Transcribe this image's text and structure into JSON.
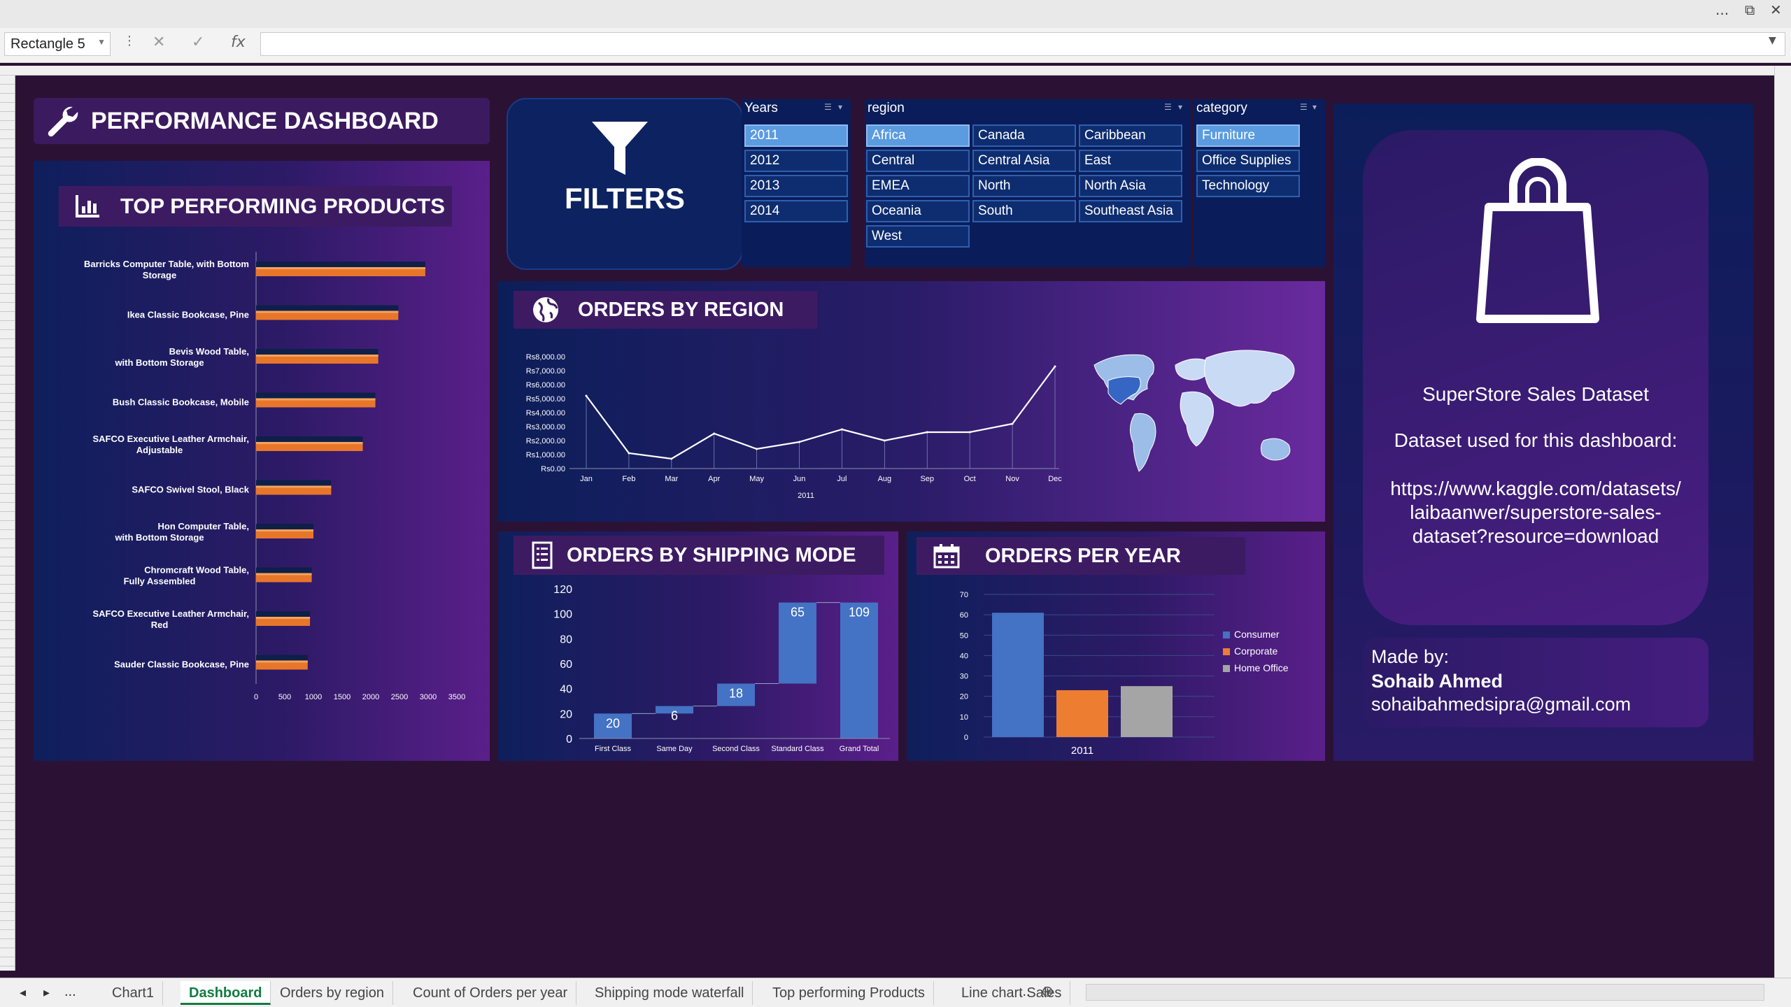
{
  "excel": {
    "name_box": "Rectangle 5",
    "formula": "",
    "sheet_tabs": [
      {
        "label": "Chart1",
        "active": false
      },
      {
        "label": "Dashboard",
        "active": true
      },
      {
        "label": "Orders by region",
        "active": false
      },
      {
        "label": "Count of Orders per year",
        "active": false
      },
      {
        "label": "Shipping mode waterfall",
        "active": false
      },
      {
        "label": "Top performing Products",
        "active": false
      },
      {
        "label": "Line chart Sales",
        "active": false
      }
    ],
    "tab_ellipsis": "...",
    "window_controls": [
      "...",
      "⧉",
      "✕"
    ]
  },
  "dashboard": {
    "main_title": "PERFORMANCE DASHBOARD",
    "filters_label": "FILTERS",
    "top_products": {
      "title": "TOP PERFORMING PRODUCTS",
      "chart_data": {
        "type": "bar",
        "orientation": "horizontal",
        "categories": [
          "Barricks Computer Table, with Bottom Storage",
          "Ikea Classic Bookcase, Pine",
          "Bevis Wood Table, with Bottom Storage",
          "Bush Classic Bookcase, Mobile",
          "SAFCO Executive Leather Armchair, Adjustable",
          "SAFCO Swivel Stool, Black",
          "Hon Computer Table, with Bottom Storage",
          "Chromcraft Wood Table, Fully Assembled",
          "SAFCO Executive Leather Armchair, Red",
          "Sauder Classic Bookcase, Pine"
        ],
        "series": [
          {
            "color": "#0e1f4a",
            "values": [
              2950,
              2480,
              2130,
              2080,
              1860,
              1310,
              1000,
              970,
              940,
              900
            ]
          },
          {
            "color": "#e8762a",
            "values": [
              2950,
              2480,
              2130,
              2080,
              1860,
              1310,
              1000,
              970,
              940,
              900
            ]
          }
        ],
        "ticks": [
          "0",
          "500",
          "1000",
          "1500",
          "2000",
          "2500",
          "3000",
          "3500"
        ],
        "xlim": [
          0,
          3500
        ]
      }
    },
    "slicers": {
      "years": {
        "header": "Years",
        "items": [
          {
            "label": "2011",
            "selected": true
          },
          {
            "label": "2012",
            "selected": false
          },
          {
            "label": "2013",
            "selected": false
          },
          {
            "label": "2014",
            "selected": false
          }
        ]
      },
      "region": {
        "header": "region",
        "items": [
          {
            "label": "Africa",
            "selected": true
          },
          {
            "label": "Canada",
            "selected": false
          },
          {
            "label": "Caribbean",
            "selected": false
          },
          {
            "label": "Central",
            "selected": false
          },
          {
            "label": "Central Asia",
            "selected": false
          },
          {
            "label": "East",
            "selected": false
          },
          {
            "label": "EMEA",
            "selected": false
          },
          {
            "label": "North",
            "selected": false
          },
          {
            "label": "North Asia",
            "selected": false
          },
          {
            "label": "Oceania",
            "selected": false
          },
          {
            "label": "South",
            "selected": false
          },
          {
            "label": "Southeast Asia",
            "selected": false
          },
          {
            "label": "West",
            "selected": false
          }
        ]
      },
      "category": {
        "header": "category",
        "items": [
          {
            "label": "Furniture",
            "selected": true
          },
          {
            "label": "Office Supplies",
            "selected": false
          },
          {
            "label": "Technology",
            "selected": false
          }
        ]
      }
    },
    "orders_by_region": {
      "title": "ORDERS BY REGION",
      "chart_data": {
        "type": "line",
        "x": [
          "Jan",
          "Feb",
          "Mar",
          "Apr",
          "May",
          "Jun",
          "Jul",
          "Aug",
          "Sep",
          "Oct",
          "Nov",
          "Dec"
        ],
        "values": [
          5200,
          1100,
          700,
          2500,
          1400,
          1900,
          2800,
          2000,
          2600,
          2600,
          3200,
          7300
        ],
        "y_ticks": [
          "Rs0.00",
          "Rs1,000.00",
          "Rs2,000.00",
          "Rs3,000.00",
          "Rs4,000.00",
          "Rs5,000.00",
          "Rs6,000.00",
          "Rs7,000.00",
          "Rs8,000.00"
        ],
        "ylim": [
          0,
          8000
        ],
        "xlabel": "2011",
        "color": "#ffffff"
      }
    },
    "shipping_mode": {
      "title": "ORDERS BY SHIPPING MODE",
      "chart_data": {
        "type": "bar",
        "subtype": "waterfall",
        "categories": [
          "First Class",
          "Same Day",
          "Second Class",
          "Standard Class",
          "Grand Total"
        ],
        "values": [
          20,
          6,
          18,
          65,
          109
        ],
        "data_labels": [
          "20",
          "6",
          "18",
          "65",
          "109"
        ],
        "y_ticks": [
          "0",
          "20",
          "40",
          "60",
          "80",
          "100",
          "120"
        ],
        "ylim": [
          0,
          120
        ],
        "color": "#4472c4"
      }
    },
    "orders_per_year": {
      "title": "ORDERS PER YEAR",
      "chart_data": {
        "type": "bar",
        "categories": [
          "2011"
        ],
        "series": [
          {
            "name": "Consumer",
            "color": "#4472c4",
            "values": [
              61
            ]
          },
          {
            "name": "Corporate",
            "color": "#ed7d31",
            "values": [
              23
            ]
          },
          {
            "name": "Home Office",
            "color": "#a5a5a5",
            "values": [
              25
            ]
          }
        ],
        "y_ticks": [
          "0",
          "10",
          "20",
          "30",
          "40",
          "50",
          "60",
          "70"
        ],
        "ylim": [
          0,
          70
        ],
        "legend": "right"
      }
    },
    "info": {
      "dataset_title": "SuperStore Sales Dataset",
      "dataset_caption": "Dataset used for this dashboard:",
      "url_lines": [
        "https://www.kaggle.com/datasets/",
        "laibaanwer/superstore-sales-",
        "dataset?resource=download"
      ],
      "made_by_label": "Made by:",
      "author": "Sohaib Ahmed",
      "email": "sohaibahmedsipra@gmail.com"
    }
  }
}
